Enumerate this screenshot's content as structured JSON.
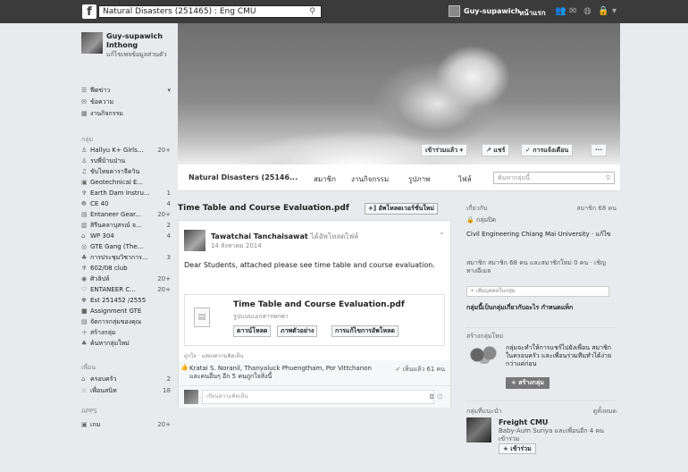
{
  "topbar": {
    "search_value": "Natural Disasters (251465) : Eng CMU",
    "user_name": "Guy-supawich",
    "home_label": "หน้าแรก"
  },
  "sidebar": {
    "profile_name": "Guy-supawich Inthong",
    "profile_edit": "แก้ไขเพจข้อมูลส่วนตัว",
    "top_items": [
      {
        "label": "ฟีดข่าว",
        "icon": "news-feed-icon"
      },
      {
        "label": "ข้อความ",
        "icon": "messages-icon"
      },
      {
        "label": "งานกิจกรรม",
        "icon": "events-icon"
      }
    ],
    "groups_title": "กลุ่ม",
    "groups": [
      {
        "label": "Hallyu K+ Girls...",
        "count": "20+"
      },
      {
        "label": "รบพี่บ้านป่าน",
        "count": ""
      },
      {
        "label": "ขับไทยคาราจีควิน",
        "count": ""
      },
      {
        "label": "Geotechnical E...",
        "count": ""
      },
      {
        "label": "Earth Dam Instru...",
        "count": "1"
      },
      {
        "label": "CE 40",
        "count": "4"
      },
      {
        "label": "Entaneer Gear...",
        "count": "20+"
      },
      {
        "label": "สิรีนคลาบุสรณ์ จ...",
        "count": "2"
      },
      {
        "label": "WP 304",
        "count": "4"
      },
      {
        "label": "GTE Gang (The...",
        "count": ""
      },
      {
        "label": "การประชุมวิชาการ...",
        "count": "3"
      },
      {
        "label": "602/08 club",
        "count": ""
      },
      {
        "label": "ศิวลิปล์",
        "count": "20+"
      },
      {
        "label": "ENTANEER C...",
        "count": "20+"
      },
      {
        "label": "Est 251452 /2555",
        "count": ""
      },
      {
        "label": "Assignment GTE",
        "count": ""
      },
      {
        "label": "จัดการกลุ่มของคุณ",
        "count": ""
      },
      {
        "label": "สร้างกลุ่ม",
        "count": ""
      },
      {
        "label": "ค้นหากลุ่มใหม่",
        "count": ""
      }
    ],
    "friends_title": "เพื่อน",
    "friends": [
      {
        "label": "ครอบครัว",
        "count": "2"
      },
      {
        "label": "เพื่อนสนิท",
        "count": "18"
      }
    ],
    "apps_title": "APPS",
    "apps": [
      {
        "label": "เกม",
        "count": "20+"
      }
    ]
  },
  "cover": {
    "joined_label": "เข้าร่วมแล้ว ▾",
    "share_label": "↗ แชร์",
    "notif_label": "✓ การแจ้งเตือน",
    "more_label": "···"
  },
  "groupnav": {
    "group_name": "Natural Disasters (25146...",
    "tabs": [
      "สมาชิก",
      "งานกิจกรรม",
      "รูปภาพ",
      "ไฟล์"
    ],
    "search_placeholder": "ค้นหากลุ่มนี้"
  },
  "main": {
    "file_title": "Time Table and Course Evaluation.pdf",
    "upload_label": "+] อัพโหลดเวอร์ชั่นใหม่",
    "post": {
      "author": "Tawatchai Tanchaisawat",
      "action": "ได้อัพโหลดไฟล์",
      "date": "14 สิงหาคม 2014",
      "text": "Dear Students, attached please see time table and course evaluation.",
      "card_title": "Time Table and Course Evaluation.pdf",
      "card_sub": "รูปแบบเอกสารพกพา",
      "btn_download": "ดาวน์โหลด",
      "btn_preview": "ภาพตัวอย่าง",
      "btn_revisions": "การแก้ไขการอัพโหลด",
      "meta": "ถูกใจ · แสดงความคิดเห็น",
      "likes": "Kratai S. Noranil, Thanyaluck Phuengtham, Por Vittchanon และคนอื่นๆ อีก 5 คนถูกใจสิ่งนี้",
      "seen": "✓ เห็นแล้ว 61 คน",
      "comment_placeholder": "เขียนความคิดเห็น"
    }
  },
  "right": {
    "about_title": "เกี่ยวกับ",
    "members_count": "สมาชิก 68 คน",
    "group_type": "🔒 กลุ่มปิด",
    "group_desc": "Civil Engineering Chiang Mai University · แก้ไข",
    "members_desc": "สมาชิก สมาชิก 68 คน และสมาชิกใหม่ 0 คน · เชิญทางอีเมล",
    "add_member_placeholder": "+ เพิ่มบุคคลในกลุ่ม",
    "about_prompt": "กลุ่มนี้เป็นกลุ่มเกี่ยวกับอะไร กำหนดแท็ก",
    "create_title": "สร้างกลุ่มใหม่",
    "create_desc": "กลุ่มจะทำให้การแชร์ไปยังเพื่อน สมาชิกในครอบครัว และเพื่อนร่วมทีมทำได้ง่ายกว่าแต่ก่อน",
    "create_btn": "+ สร้างกลุ่ม",
    "suggested_title": "กลุ่มที่แนะนำ",
    "see_all": "ดูทั้งหมด",
    "suggested_name": "Freight CMU",
    "suggested_desc": "Baby-Aum Suriya และเพื่อนอีก 4 คน เข้าร่วม",
    "join_btn": "+ เข้าร่วม"
  }
}
